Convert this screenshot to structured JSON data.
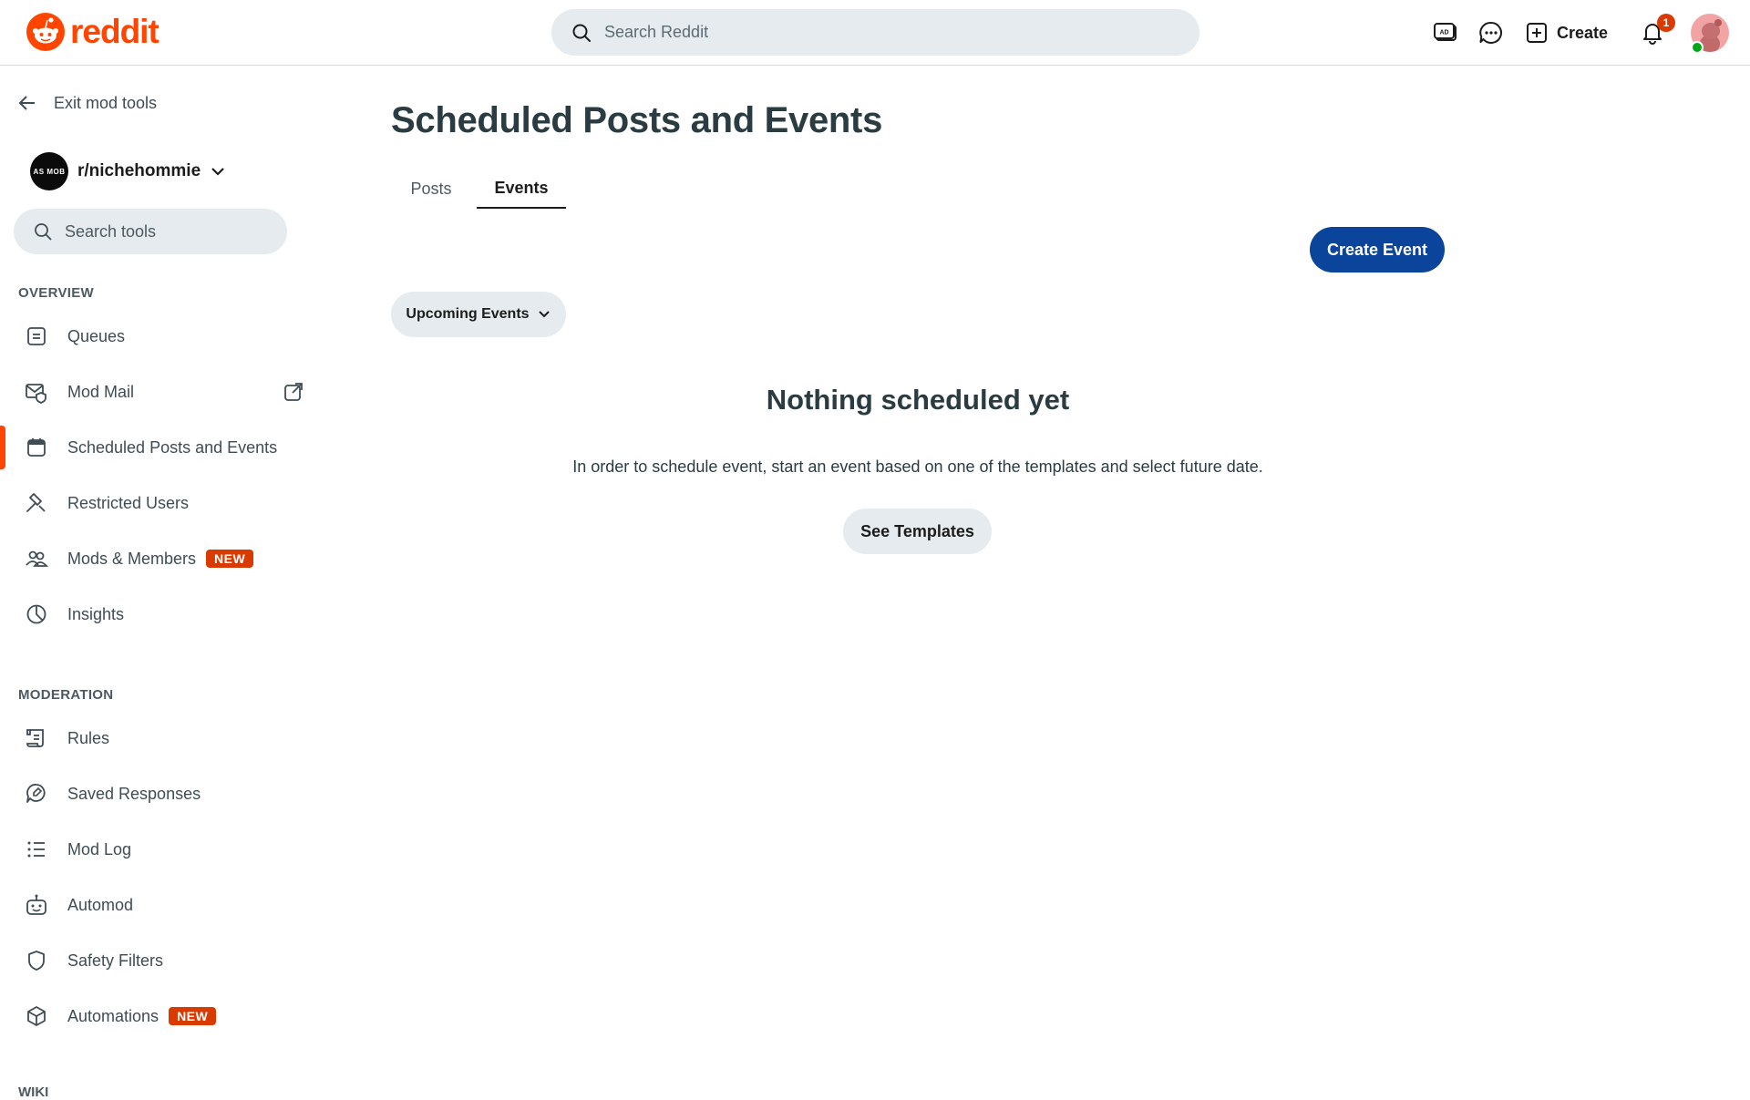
{
  "header": {
    "brand": "reddit",
    "search_placeholder": "Search Reddit",
    "create_label": "Create",
    "notification_count": "1"
  },
  "sidebar": {
    "exit_label": "Exit mod tools",
    "subreddit": {
      "name": "r/nichehommie",
      "avatar_text": "AS MOB"
    },
    "search_placeholder": "Search tools",
    "overview_heading": "OVERVIEW",
    "overview_items": [
      {
        "label": "Queues",
        "icon": "queue-icon"
      },
      {
        "label": "Mod Mail",
        "icon": "mod-mail-icon",
        "external": true
      },
      {
        "label": "Scheduled Posts and Events",
        "icon": "calendar-icon",
        "active": true
      },
      {
        "label": "Restricted Users",
        "icon": "hammer-icon"
      },
      {
        "label": "Mods & Members",
        "icon": "members-icon",
        "badge": "NEW"
      },
      {
        "label": "Insights",
        "icon": "pie-chart-icon"
      }
    ],
    "moderation_heading": "MODERATION",
    "moderation_items": [
      {
        "label": "Rules",
        "icon": "scroll-icon"
      },
      {
        "label": "Saved Responses",
        "icon": "speech-bubble-icon"
      },
      {
        "label": "Mod Log",
        "icon": "list-icon"
      },
      {
        "label": "Automod",
        "icon": "robot-icon"
      },
      {
        "label": "Safety Filters",
        "icon": "shield-icon"
      },
      {
        "label": "Automations",
        "icon": "cube-icon",
        "badge": "NEW"
      }
    ],
    "wiki_heading": "WIKI"
  },
  "main": {
    "title": "Scheduled Posts and Events",
    "tabs": [
      {
        "label": "Posts",
        "active": false
      },
      {
        "label": "Events",
        "active": true
      }
    ],
    "create_event_label": "Create Event",
    "filter_label": "Upcoming Events",
    "empty_title": "Nothing scheduled yet",
    "empty_description": "In order to schedule event, start an event based on one of the templates and select future date.",
    "see_templates_label": "See Templates"
  },
  "colors": {
    "brand": "#ff4500",
    "primary_button": "#0a449b",
    "badge": "#d93a00",
    "pill_bg": "#e5ebee"
  }
}
